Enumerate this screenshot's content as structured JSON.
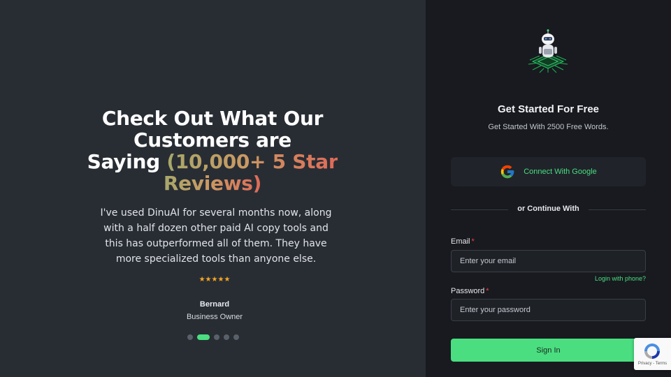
{
  "left": {
    "headline_white_1": "Check Out What Our",
    "headline_white_2": "Customers are",
    "headline_white_3": "Saying ",
    "headline_gradient_1": "(10,000+ 5 Star",
    "headline_gradient_2": "Reviews)",
    "quote": "I've used DinuAI for several months now, along with a half dozen other paid AI copy tools and this has outperformed all of them. They have more specialized tools than anyone else.",
    "stars": "★★★★★",
    "rating": 5,
    "author": "Bernard",
    "role": "Business Owner",
    "carousel": {
      "count": 5,
      "active_index": 1
    }
  },
  "right": {
    "title": "Get Started For Free",
    "subtitle": "Get Started With 2500 Free Words.",
    "google_button": "Connect With Google",
    "divider": "or Continue With",
    "email_label": "Email",
    "email_placeholder": "Enter your email",
    "phone_link": "Login with phone?",
    "password_label": "Password",
    "password_placeholder": "Enter your password",
    "required_mark": "*",
    "signin_button": "Sign In"
  },
  "recaptcha": {
    "text": "Privacy - Terms"
  },
  "colors": {
    "accent": "#4ade80",
    "left_bg": "#282d34",
    "right_bg": "#181a1f",
    "star": "#f6a623",
    "required": "#ef4444"
  },
  "icons": [
    "robot-logo-icon",
    "google-icon",
    "recaptcha-icon"
  ]
}
